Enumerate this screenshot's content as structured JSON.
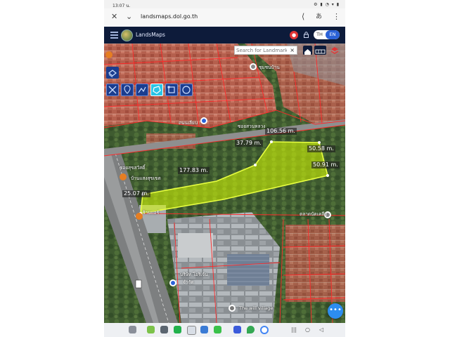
{
  "status": {
    "time": "13:07 น.",
    "right_icons": "⚙ ▮ ◔ ▾ ▮"
  },
  "browser": {
    "url": "landsmaps.dol.go.th",
    "close_glyph": "✕",
    "expand_glyph": "⌄",
    "share_glyph": "⟨",
    "translate_glyph": "あ",
    "more_glyph": "⋮"
  },
  "app": {
    "name": "LandsMaps",
    "lang_th": "TH",
    "lang_en": "EN"
  },
  "search": {
    "placeholder": "Search for Landmark",
    "clear": "×"
  },
  "measurements": {
    "top": "106.56 m.",
    "left_top": "37.79 m.",
    "right_top": "50.58 m.",
    "right": "50.91 m.",
    "middle": "177.83 m.",
    "left": "25.07 m."
  },
  "fab_glyph": "•••",
  "nav": {
    "recents": "|||",
    "home": "○",
    "back": "◁"
  },
  "colors": {
    "appbar": "#0d1b3a",
    "parcel_fill": "#d9ff00",
    "parcel_outline": "#e8ff40",
    "boundary_lines": "#ff2a2a",
    "accent_blue": "#2b62d8"
  }
}
